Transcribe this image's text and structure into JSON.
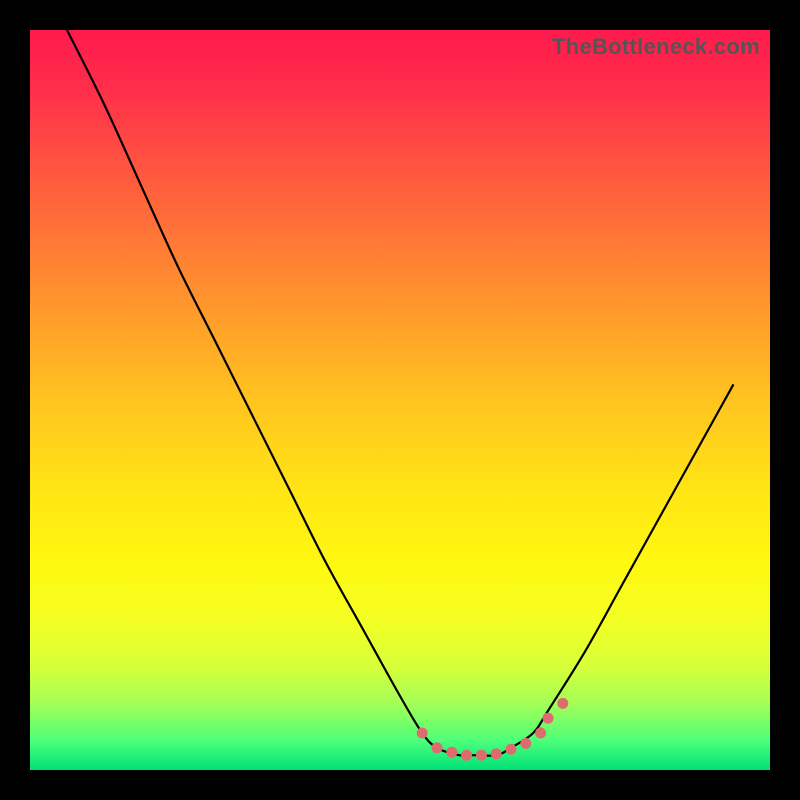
{
  "watermark": "TheBottleneck.com",
  "gradient": {
    "stops": [
      {
        "offset": 0.0,
        "color": "#ff1a4d"
      },
      {
        "offset": 0.08,
        "color": "#ff2e4a"
      },
      {
        "offset": 0.2,
        "color": "#ff5a3e"
      },
      {
        "offset": 0.35,
        "color": "#ff8f2f"
      },
      {
        "offset": 0.5,
        "color": "#ffc41f"
      },
      {
        "offset": 0.62,
        "color": "#ffe414"
      },
      {
        "offset": 0.72,
        "color": "#fff80f"
      },
      {
        "offset": 0.8,
        "color": "#f3ff24"
      },
      {
        "offset": 0.86,
        "color": "#d6ff3a"
      },
      {
        "offset": 0.91,
        "color": "#a3ff56"
      },
      {
        "offset": 0.96,
        "color": "#4dff7a"
      },
      {
        "offset": 1.0,
        "color": "#00e278"
      }
    ]
  },
  "chart_data": {
    "type": "line",
    "title": "",
    "xlabel": "",
    "ylabel": "",
    "xlim": [
      0,
      100
    ],
    "ylim": [
      0,
      100
    ],
    "series": [
      {
        "name": "bottleneck-curve",
        "x": [
          5,
          10,
          15,
          20,
          25,
          30,
          35,
          40,
          45,
          50,
          53,
          55,
          58,
          60,
          63,
          65,
          68,
          70,
          75,
          80,
          85,
          90,
          95
        ],
        "y": [
          100,
          90,
          79,
          68,
          58,
          48,
          38,
          28,
          19,
          10,
          5,
          3,
          2,
          2,
          2,
          3,
          5,
          8,
          16,
          25,
          34,
          43,
          52
        ]
      }
    ],
    "markers": {
      "name": "highlighted-range",
      "color": "#e06b6e",
      "x": [
        53,
        55,
        57,
        59,
        61,
        63,
        65,
        67,
        69,
        70,
        72
      ],
      "y": [
        5,
        3,
        2.4,
        2,
        2,
        2.2,
        2.8,
        3.6,
        5,
        7,
        9
      ]
    }
  }
}
